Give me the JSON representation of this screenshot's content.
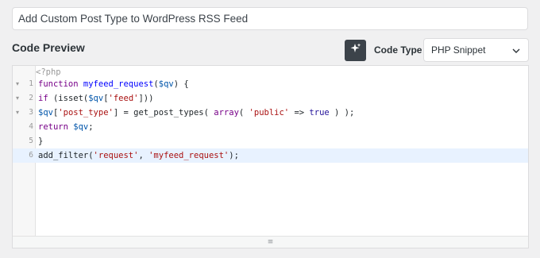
{
  "snippet": {
    "title": "Add Custom Post Type to WordPress RSS Feed"
  },
  "preview": {
    "heading": "Code Preview",
    "ai_icon": "sparkle-icon",
    "code_type_label": "Code Type",
    "code_type_value": "PHP Snippet",
    "select_icon": "chevron-down-icon"
  },
  "editor": {
    "php_open": "<?php",
    "lines": [
      {
        "num": "1",
        "fold": "▾"
      },
      {
        "num": "2",
        "fold": "▾"
      },
      {
        "num": "3",
        "fold": "▾"
      },
      {
        "num": "4",
        "fold": ""
      },
      {
        "num": "5",
        "fold": ""
      },
      {
        "num": "6",
        "fold": ""
      }
    ],
    "tokens": {
      "l1": [
        "function",
        "myfeed_request",
        "(",
        "$qv",
        ") {"
      ],
      "l2": [
        "if",
        " (isset(",
        "$qv",
        "[",
        "'feed'",
        "]))"
      ],
      "l3": [
        "$qv",
        "[",
        "'post_type'",
        "] = get_post_types( ",
        "array",
        "( ",
        "'public'",
        " => ",
        "true",
        " ) );"
      ],
      "l4": [
        "return",
        " ",
        "$qv",
        ";"
      ],
      "l5": [
        "}"
      ],
      "l6": [
        "add_filter(",
        "'request'",
        ", ",
        "'myfeed_request'",
        ");"
      ]
    },
    "resize_icon": "drag-handle-icon",
    "resize_glyph": "≡",
    "fold_icon": "fold-arrow-icon"
  }
}
